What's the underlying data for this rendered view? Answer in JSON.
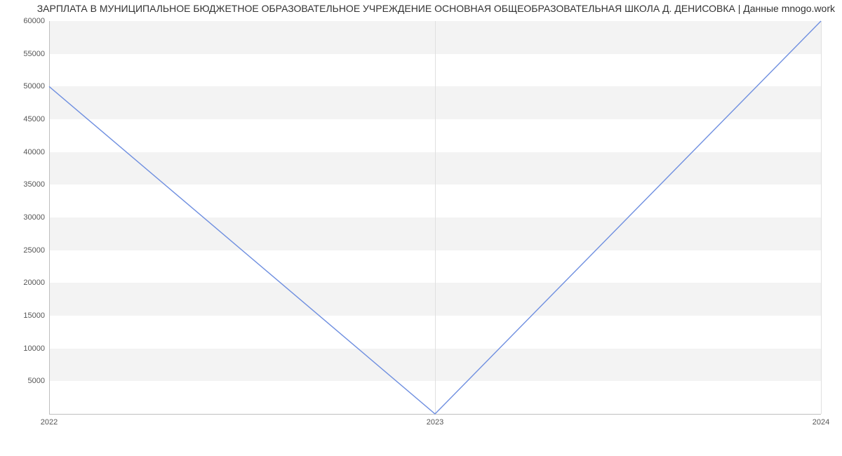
{
  "title": "ЗАРПЛАТА В МУНИЦИПАЛЬНОЕ БЮДЖЕТНОЕ ОБРАЗОВАТЕЛЬНОЕ УЧРЕЖДЕНИЕ ОСНОВНАЯ ОБЩЕОБРАЗОВАТЕЛЬНАЯ ШКОЛА Д. ДЕНИСОВКА | Данные mnogo.work",
  "chart_data": {
    "type": "line",
    "x": [
      2022,
      2023,
      2024
    ],
    "values": [
      50000,
      0,
      60000
    ],
    "x_ticks": [
      2022,
      2023,
      2024
    ],
    "y_ticks": [
      5000,
      10000,
      15000,
      20000,
      25000,
      30000,
      35000,
      40000,
      45000,
      50000,
      55000,
      60000
    ],
    "xlim": [
      2022,
      2024
    ],
    "ylim": [
      0,
      60000
    ],
    "line_color": "#6f8fe0",
    "band_color": "#f3f3f3"
  }
}
